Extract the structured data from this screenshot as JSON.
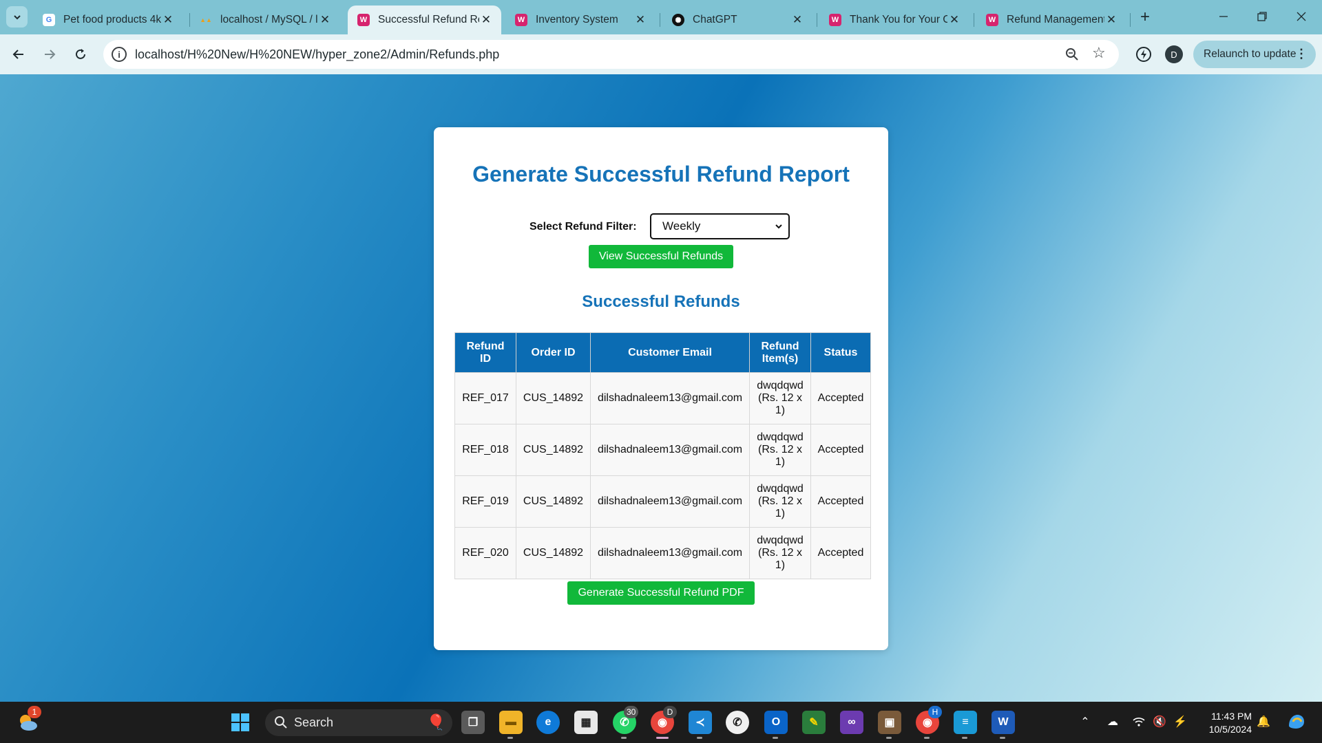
{
  "browser": {
    "tabs": [
      {
        "label": "Pet food products 4k",
        "favicon": "google-icon"
      },
      {
        "label": "localhost / MySQL / l",
        "favicon": "phpmyadmin-icon"
      },
      {
        "label": "Successful Refund Re",
        "favicon": "wamp-icon",
        "active": true
      },
      {
        "label": "Inventory System",
        "favicon": "wamp-icon"
      },
      {
        "label": "ChatGPT",
        "favicon": "chatgpt-icon"
      },
      {
        "label": "Thank You for Your C",
        "favicon": "wamp-icon"
      },
      {
        "label": "Refund Management",
        "favicon": "wamp-icon"
      }
    ],
    "url": "localhost/H%20New/H%20NEW/hyper_zone2/Admin/Refunds.php",
    "profile_initial": "D",
    "relaunch_label": "Relaunch to update"
  },
  "page": {
    "title": "Generate Successful Refund Report",
    "filter_label": "Select Refund Filter:",
    "filter_value": "Weekly",
    "view_button": "View Successful Refunds",
    "section_title": "Successful Refunds",
    "table": {
      "headers": [
        "Refund ID",
        "Order ID",
        "Customer Email",
        "Refund Item(s)",
        "Status"
      ],
      "rows": [
        {
          "refund_id": "REF_017",
          "order_id": "CUS_14892",
          "email": "dilshadnaleem13@gmail.com",
          "items": "dwqdqwd (Rs. 12 x 1)",
          "status": "Accepted"
        },
        {
          "refund_id": "REF_018",
          "order_id": "CUS_14892",
          "email": "dilshadnaleem13@gmail.com",
          "items": "dwqdqwd (Rs. 12 x 1)",
          "status": "Accepted"
        },
        {
          "refund_id": "REF_019",
          "order_id": "CUS_14892",
          "email": "dilshadnaleem13@gmail.com",
          "items": "dwqdqwd (Rs. 12 x 1)",
          "status": "Accepted"
        },
        {
          "refund_id": "REF_020",
          "order_id": "CUS_14892",
          "email": "dilshadnaleem13@gmail.com",
          "items": "dwqdqwd (Rs. 12 x 1)",
          "status": "Accepted"
        }
      ]
    },
    "pdf_button": "Generate Successful Refund PDF"
  },
  "taskbar": {
    "weather_badge": "1",
    "search_label": "Search",
    "whatsapp_badge": "30",
    "chrome_profile_1": "D",
    "chrome_profile_2": "H",
    "time": "11:43 PM",
    "date": "10/5/2024"
  },
  "colors": {
    "accent_blue": "#1673b8",
    "table_header": "#0b6cb3",
    "button_green": "#11b83a"
  }
}
